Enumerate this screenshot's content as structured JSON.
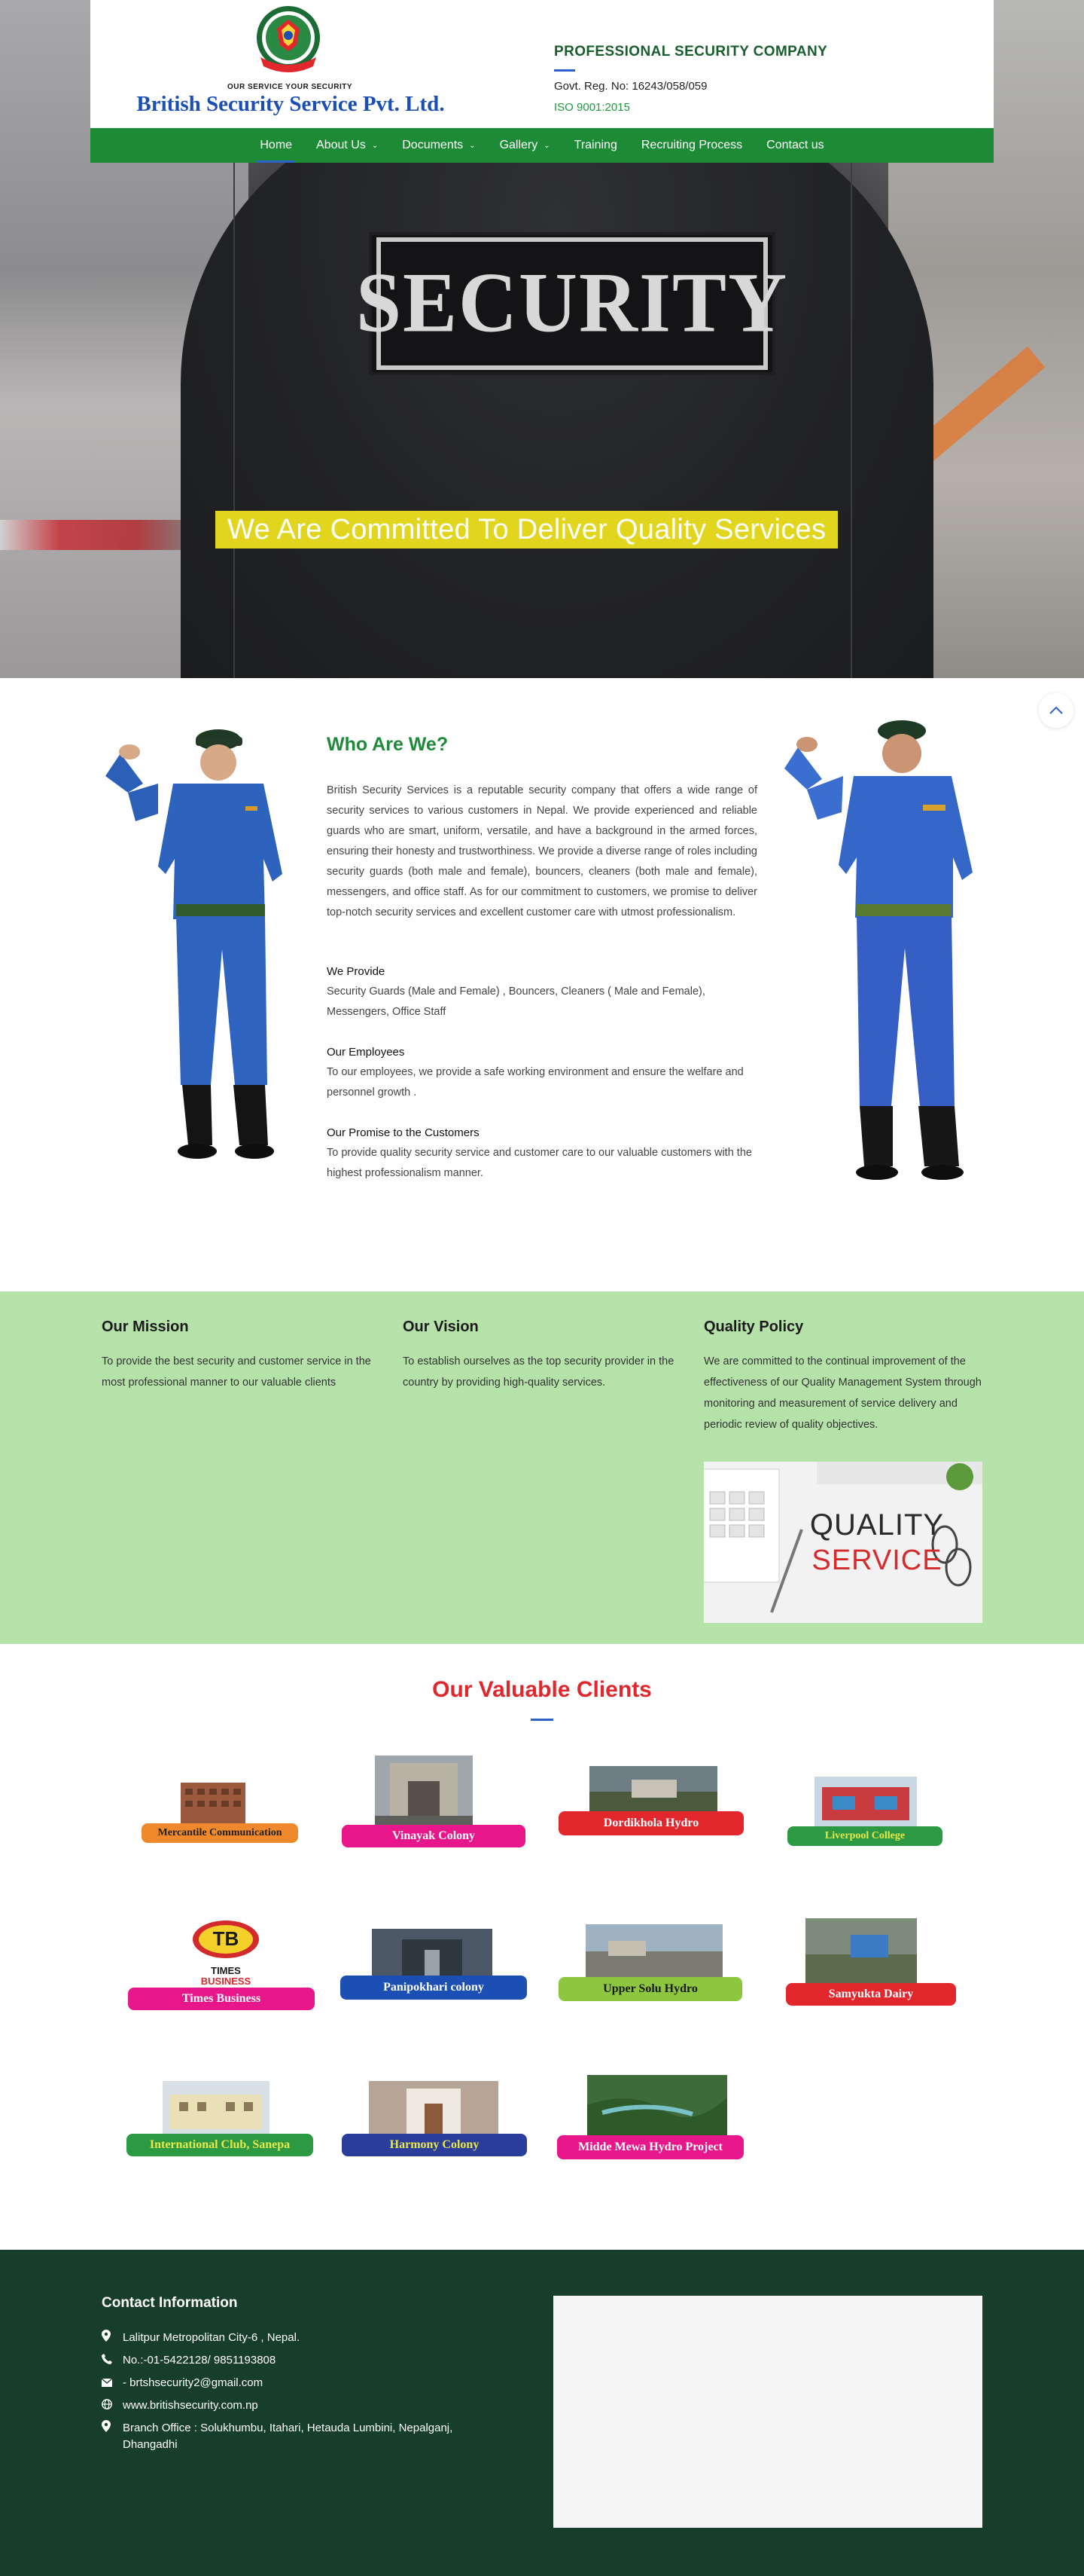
{
  "header": {
    "logo_slogan": "OUR SERVICE YOUR SECURITY",
    "logo_name": "British Security Service Pvt. Ltd.",
    "company_type": "PROFESSIONAL SECURITY COMPANY",
    "reg_no": "Govt. Reg. No: 16243/058/059",
    "iso": "ISO 9001:2015"
  },
  "nav": {
    "items": [
      {
        "label": "Home",
        "active": true,
        "dropdown": false
      },
      {
        "label": "About Us",
        "active": false,
        "dropdown": true
      },
      {
        "label": "Documents",
        "active": false,
        "dropdown": true
      },
      {
        "label": "Gallery",
        "active": false,
        "dropdown": true
      },
      {
        "label": "Training",
        "active": false,
        "dropdown": false
      },
      {
        "label": "Recruiting Process",
        "active": false,
        "dropdown": false
      },
      {
        "label": "Contact us",
        "active": false,
        "dropdown": false
      }
    ]
  },
  "hero": {
    "patch_text": "SECURITY",
    "tagline": "We Are Committed To Deliver Quality Services"
  },
  "about": {
    "title": "Who Are We?",
    "intro": "British Security Services is a reputable security company that offers a wide range of security services to various customers in Nepal. We provide experienced and reliable guards who are smart, uniform, versatile, and have a background in the armed forces, ensuring their honesty and trustworthiness. We provide a diverse range of roles including security guards (both male and female), bouncers, cleaners (both male and female), messengers, and office staff. As for our commitment to customers, we promise to deliver top-notch security services and excellent customer care with utmost professionalism.",
    "provide_heading": "We Provide",
    "provide_text": "Security Guards (Male and Female) , Bouncers, Cleaners ( Male and Female), Messengers, Office Staff",
    "employees_heading": "Our Employees",
    "employees_text": "To our employees, we provide a safe working environment and ensure the welfare and personnel growth .",
    "promise_heading": "Our Promise to the Customers",
    "promise_text": "To provide quality security service and customer care to our valuable customers with the highest professionalism manner."
  },
  "mission": {
    "mission_title": "Our Mission",
    "mission_text": "To provide the best security and customer service in the most professional manner to our valuable clients",
    "vision_title": "Our Vision",
    "vision_text": "To establish ourselves as the top security provider in the country by providing high-quality services.",
    "policy_title": "Quality Policy",
    "policy_text": "We are committed to the continual improvement of the effectiveness of our Quality Management System through monitoring and measurement of service delivery and periodic review of quality objectives.",
    "image_word1": "QUALITY",
    "image_word2": "SERVICE"
  },
  "clients": {
    "title": "Our Valuable Clients",
    "list": [
      {
        "name": "Mercantile Communication",
        "pill_color": "#f0892c",
        "text_color": "#222222"
      },
      {
        "name": "Vinayak Colony",
        "pill_color": "#e8168b",
        "text_color": "#ffffff"
      },
      {
        "name": "Dordikhola Hydro",
        "pill_color": "#e1262c",
        "text_color": "#ffffff"
      },
      {
        "name": "Liverpool College",
        "pill_color": "#2b9a43",
        "text_color": "#e8e84a"
      },
      {
        "name": "Times Business",
        "pill_color": "#e8168b",
        "text_color": "#ffffff"
      },
      {
        "name": "Panipokhari colony",
        "pill_color": "#1c4fb4",
        "text_color": "#ffffff"
      },
      {
        "name": "Upper Solu Hydro",
        "pill_color": "#8dc63f",
        "text_color": "#1a1a1a"
      },
      {
        "name": "Samyukta Dairy",
        "pill_color": "#e1262c",
        "text_color": "#ffffff"
      },
      {
        "name": "International Club, Sanepa",
        "pill_color": "#2b9a43",
        "text_color": "#e8e84a"
      },
      {
        "name": "Harmony Colony",
        "pill_color": "#2a3d9a",
        "text_color": "#e8e84a"
      },
      {
        "name": "Midde Mewa Hydro Project",
        "pill_color": "#e8168b",
        "text_color": "#ffffff"
      }
    ],
    "times_logo_top": "TB",
    "times_logo_word1": "TIMES",
    "times_logo_word2": "BUSINESS"
  },
  "footer": {
    "title": "Contact Information",
    "address": "Lalitpur Metropolitan City-6 , Nepal.",
    "phone": "No.:-01-5422128/ 9851193808",
    "email": "- brtshsecurity2@gmail.com",
    "website": "www.britishsecurity.com.np",
    "branch": "Branch Office : Solukhumbu, Itahari, Hetauda Lumbini, Nepalganj, Dhangadhi"
  },
  "icons": {
    "scroll_top": "chevron-up-icon",
    "address": "map-marker-icon",
    "phone": "phone-icon",
    "email": "envelope-icon",
    "website": "globe-icon",
    "branch": "map-marker-icon"
  },
  "colors": {
    "brand_green": "#1d8a35",
    "brand_blue": "#1c4fb4",
    "mission_bg": "#b5e2a9",
    "footer_bg": "#173d2b",
    "tagline_bg": "#e2d51e",
    "clients_title": "#e1262c"
  }
}
